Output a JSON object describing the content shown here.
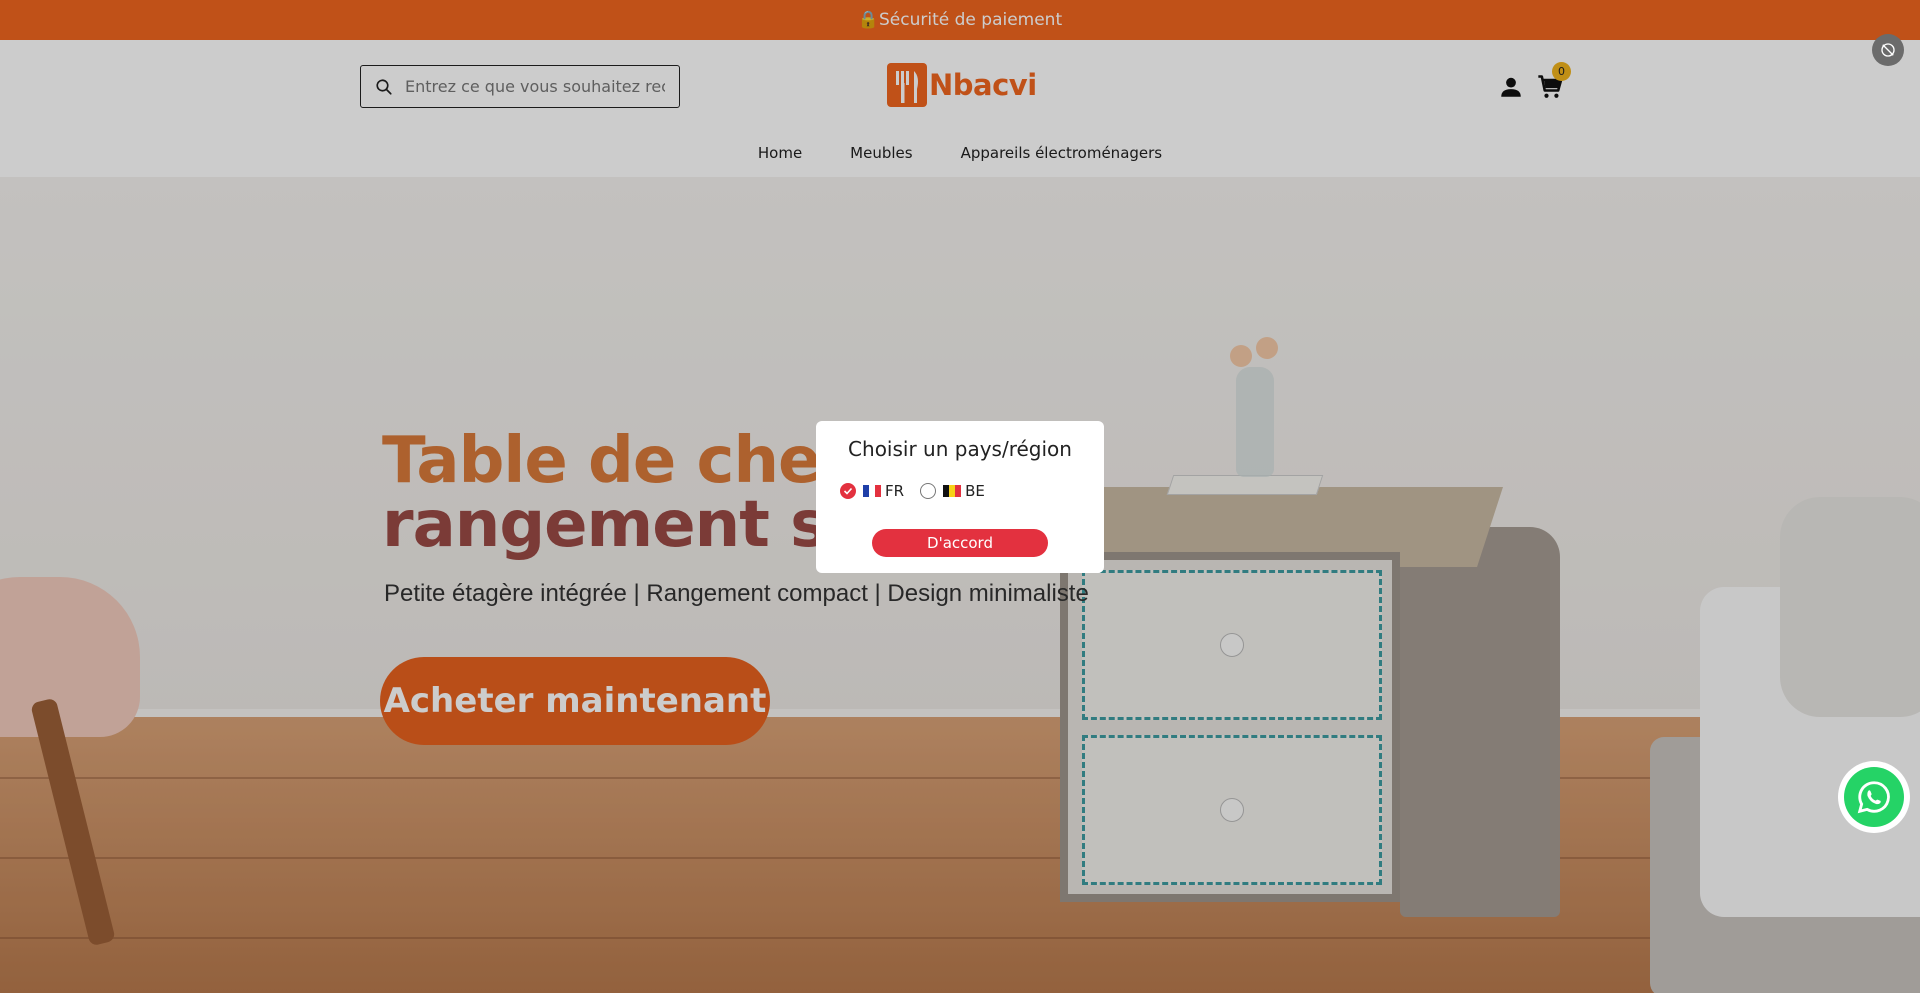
{
  "announcement": {
    "text": "🔒Sécurité de paiement"
  },
  "header": {
    "search_placeholder": "Entrez ce que vous souhaitez rechercher",
    "logo_text": "Nbacvi",
    "cart_count": "0"
  },
  "nav": {
    "items": [
      "Home",
      "Meubles",
      "Appareils électroménagers"
    ]
  },
  "hero": {
    "title_line1": "Table de chevet",
    "title_line2": "rangement simple",
    "subtitle": "Petite étagère intégrée | Rangement compact | Design minimaliste",
    "cta": "Acheter maintenant"
  },
  "modal": {
    "title": "Choisir un pays/région",
    "options": [
      {
        "code": "FR",
        "selected": true
      },
      {
        "code": "BE",
        "selected": false
      }
    ],
    "confirm": "D'accord"
  },
  "colors": {
    "brand_orange": "#f0661f",
    "accent_red": "#e3313f",
    "badge_yellow": "#f1b31c",
    "whatsapp_green": "#25d366"
  }
}
